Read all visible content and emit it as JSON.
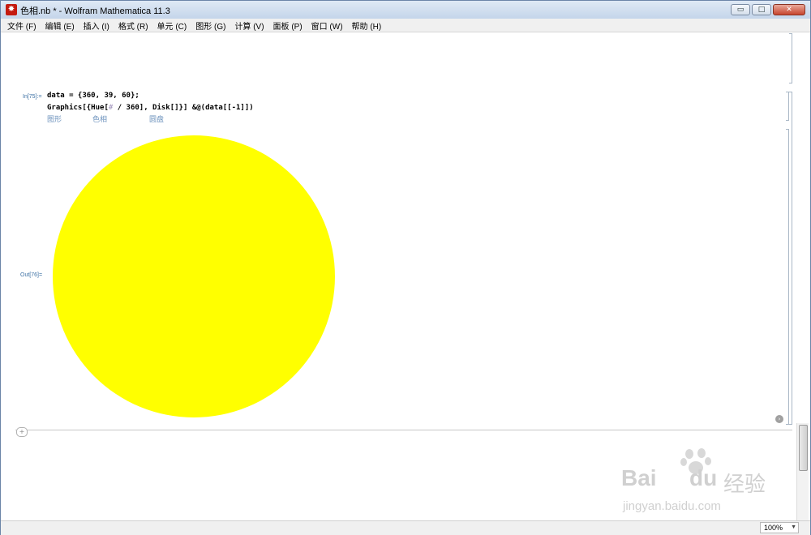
{
  "window": {
    "title": "色相.nb * - Wolfram Mathematica 11.3",
    "app_icon": "mathematica-spikey-icon",
    "buttons": {
      "minimize": "▭",
      "maximize": "□",
      "close": "✕"
    }
  },
  "menu": {
    "items": [
      "文件 (F)",
      "编辑 (E)",
      "插入 (I)",
      "格式 (R)",
      "单元 (C)",
      "图形 (G)",
      "计算 (V)",
      "面板 (P)",
      "窗口 (W)",
      "帮助 (H)"
    ]
  },
  "cell": {
    "in_label": "In[75]:=",
    "line1": "data = {360, 39, 60};",
    "line2_a": "Graphics[{Hue[",
    "line2_sharp": "#",
    "line2_b": " / 360], Disk[]}] &@(data[[-1]])",
    "hints": [
      "图形",
      "色相",
      "圆盘"
    ],
    "out_label": "Out[76]=",
    "disk_color": "#ffff00"
  },
  "bottom": {
    "add_cell": "+",
    "zoom": "100%"
  },
  "watermark": {
    "brand": "Bai",
    "brand_tail": "du",
    "suffix": "经验",
    "url": "jingyan.baidu.com"
  }
}
